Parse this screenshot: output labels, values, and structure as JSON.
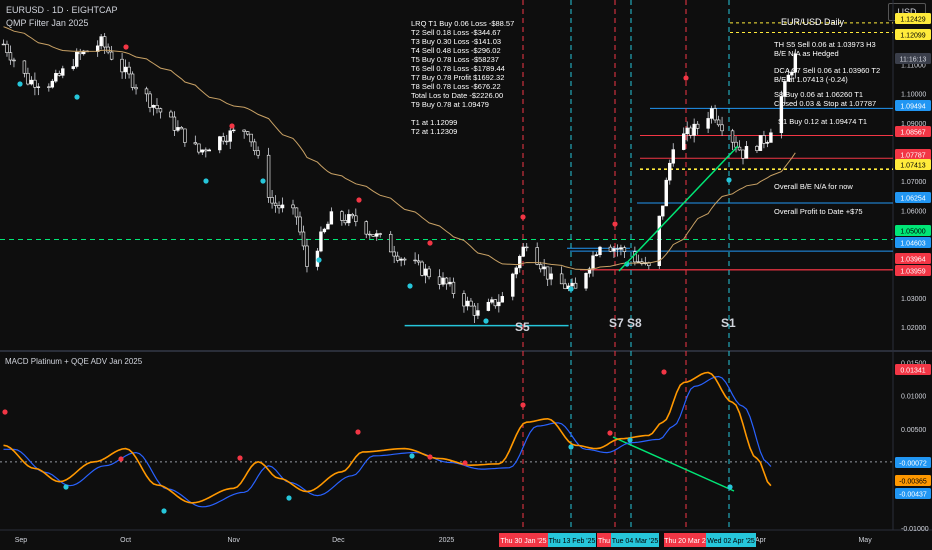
{
  "header": {
    "symbol_line": "EURUSD · 1D · EIGHTCAP",
    "indicator_line": "QMP Filter Jan 2025",
    "currency_button": "USD",
    "lower_indicator_title": "MACD Platinum + QQE ADV Jan 2025"
  },
  "annotations": {
    "trade_log": [
      "LRQ T1 Buy 0.06 Loss -$88.57",
      "T2 Sell 0.18 Loss -$344.67",
      "T3 Buy 0.30 Loss -$141.03",
      "T4 Sell 0.48 Loss -$296.02",
      "T5 Buy 0.78 Loss -$58237",
      "T6 Sell 0.78 Loss -$1789.44",
      "T7 Buy 0.78 Profit $1692.32",
      "T8 Sell 0.78 Loss -$676.22",
      "Total Los to Date -$2226.00",
      "T9 Buy 0.78 at 1.09479",
      "",
      "T1 at 1.12099",
      "T2 at 1.12309"
    ],
    "title_right": "EUR/USD Daily",
    "th_s5": [
      "TH S5 Sell 0.06 at 1.03973 H3",
      "B/E N/A as Hedged"
    ],
    "dca_s7": [
      "DCA S7 Sell 0.06 at 1.03960 T2",
      "B/E at 1.07413 (-0.24)"
    ],
    "s8": [
      "S8 Buy 0.06 at 1.06260 T1",
      "Closed 0.03 & Stop at 1.07787"
    ],
    "s1": "S1 Buy 0.12 at 1.09474 T1",
    "overall_be": "Overall B/E N/A for now",
    "overall_profit": "Overall Profit to Date +$75",
    "signals": [
      "S5",
      "S7",
      "S8",
      "S1"
    ]
  },
  "price_axis": {
    "ticks": [
      "1.11000",
      "1.10000",
      "1.09000",
      "1.08000",
      "1.07000",
      "1.06000",
      "1.05000",
      "1.04000",
      "1.03000",
      "1.02000"
    ],
    "badges": [
      {
        "label": "1.12429",
        "value": 1.12429,
        "bg": "#ffeb3b",
        "fg": "#000000"
      },
      {
        "label": "1.12099",
        "value": 1.12099,
        "bg": "#ffeb3b",
        "fg": "#000000"
      },
      {
        "label": "11:16:13",
        "value": 1.111,
        "bg": "#3a3e4a",
        "fg": "#d1d4dc"
      },
      {
        "label": "1.09494",
        "value": 1.09494,
        "bg": "#2196f3",
        "fg": "#ffffff"
      },
      {
        "label": "1.08567",
        "value": 1.08567,
        "bg": "#f23645",
        "fg": "#ffffff"
      },
      {
        "label": "1.07787",
        "value": 1.07787,
        "bg": "#f23645",
        "fg": "#ffffff"
      },
      {
        "label": "1.07413",
        "value": 1.07413,
        "bg": "#ffeb3b",
        "fg": "#000000"
      },
      {
        "label": "1.06254",
        "value": 1.06254,
        "bg": "#2196f3",
        "fg": "#ffffff"
      },
      {
        "label": "1.05000",
        "value": 1.05,
        "bg": "#00e676",
        "fg": "#000000"
      },
      {
        "label": "1.04603",
        "value": 1.04603,
        "bg": "#2196f3",
        "fg": "#ffffff"
      },
      {
        "label": "1.03964",
        "value": 1.03964,
        "bg": "#f23645",
        "fg": "#ffffff"
      },
      {
        "label": "1.03959",
        "value": 1.03959,
        "bg": "#f23645",
        "fg": "#ffffff"
      }
    ]
  },
  "macd_axis": {
    "ticks": [
      "0.01500",
      "0.01000",
      "0.00500",
      "0.00000",
      "-0.00500",
      "-0.01000"
    ],
    "badges": [
      {
        "label": "0.01341",
        "value": 0.01341,
        "bg": "#f23645",
        "fg": "#ffffff"
      },
      {
        "label": "-0.00072",
        "value": -0.00072,
        "bg": "#2196f3",
        "fg": "#ffffff"
      },
      {
        "label": "-0.00365",
        "value": -0.00365,
        "bg": "#ff9800",
        "fg": "#000000"
      },
      {
        "label": "-0.00437",
        "value": -0.00437,
        "bg": "#2196f3",
        "fg": "#ffffff"
      }
    ]
  },
  "time_axis": {
    "months": [
      "Sep",
      "Oct",
      "Nov",
      "Dec",
      "2025",
      "Feb",
      "Mar",
      "Apr",
      "May"
    ],
    "date_badges": [
      {
        "label": "Thu 30 Jan '25",
        "color": "#f23645"
      },
      {
        "label": "Thu 13 Feb '25",
        "color": "#26c6da"
      },
      {
        "label": "Thu",
        "color": "#f23645"
      },
      {
        "label": "Tue 04 Mar '25",
        "color": "#26c6da"
      },
      {
        "label": "Thu 20 Mar 2",
        "color": "#f23645"
      },
      {
        "label": "Wed 02 Apr '25",
        "color": "#26c6da"
      }
    ]
  },
  "colors": {
    "background": "#0e0e0e",
    "up_candle": "#ffffff",
    "down_candle": "#ffffff",
    "ma_line": "#c8a165",
    "macd_fast": "#ff9800",
    "macd_slow": "#2962ff",
    "signal_red": "#f23645",
    "signal_cyan": "#26c6da",
    "trend_green": "#00e676"
  },
  "chart_data": [
    {
      "type": "candlestick",
      "title": "EURUSD · 1D · EIGHTCAP",
      "x_range": [
        "2024-08-26",
        "2025-05-09"
      ],
      "ylim": [
        1.0135,
        1.128
      ],
      "close_path": [
        {
          "date": "2024-08-27",
          "close": 1.117
        },
        {
          "date": "2024-09-03",
          "close": 1.1045
        },
        {
          "date": "2024-09-10",
          "close": 1.1035
        },
        {
          "date": "2024-09-17",
          "close": 1.1125
        },
        {
          "date": "2024-09-24",
          "close": 1.1175
        },
        {
          "date": "2024-10-01",
          "close": 1.107
        },
        {
          "date": "2024-10-08",
          "close": 1.0975
        },
        {
          "date": "2024-10-15",
          "close": 1.089
        },
        {
          "date": "2024-10-22",
          "close": 1.08
        },
        {
          "date": "2024-10-29",
          "close": 1.0855
        },
        {
          "date": "2024-11-05",
          "close": 1.088
        },
        {
          "date": "2024-11-12",
          "close": 1.0625
        },
        {
          "date": "2024-11-19",
          "close": 1.058
        },
        {
          "date": "2024-11-22",
          "close": 1.041
        },
        {
          "date": "2024-11-29",
          "close": 1.0575
        },
        {
          "date": "2024-12-06",
          "close": 1.0565
        },
        {
          "date": "2024-12-13",
          "close": 1.05
        },
        {
          "date": "2024-12-20",
          "close": 1.043
        },
        {
          "date": "2024-12-31",
          "close": 1.0355
        },
        {
          "date": "2025-01-10",
          "close": 1.0245
        },
        {
          "date": "2025-01-17",
          "close": 1.03
        },
        {
          "date": "2025-01-24",
          "close": 1.0495
        },
        {
          "date": "2025-01-31",
          "close": 1.036
        },
        {
          "date": "2025-02-07",
          "close": 1.0325
        },
        {
          "date": "2025-02-14",
          "close": 1.049
        },
        {
          "date": "2025-02-21",
          "close": 1.046
        },
        {
          "date": "2025-02-28",
          "close": 1.04
        },
        {
          "date": "2025-03-04",
          "close": 1.0625
        },
        {
          "date": "2025-03-07",
          "close": 1.083
        },
        {
          "date": "2025-03-14",
          "close": 1.0885
        },
        {
          "date": "2025-03-18",
          "close": 1.0945
        },
        {
          "date": "2025-03-27",
          "close": 1.0795
        },
        {
          "date": "2025-04-03",
          "close": 1.085
        },
        {
          "date": "2025-04-11",
          "close": 1.1125
        }
      ],
      "horizontal_levels": [
        1.12429,
        1.12099,
        1.09494,
        1.08567,
        1.07787,
        1.07413,
        1.06254,
        1.05,
        1.04603,
        1.03964,
        1.03959
      ],
      "support_line": {
        "from": {
          "date": "2024-12-20",
          "price": 1.0205
        },
        "to": {
          "date": "2025-02-05",
          "price": 1.0205
        }
      }
    },
    {
      "type": "line",
      "title": "MACD Platinum + QQE ADV Jan 2025",
      "ylim": [
        -0.01,
        0.016
      ],
      "series": [
        {
          "name": "",
          "values": [
            {
              "date": "2024-08-27",
              "value": 0.0025
            },
            {
              "date": "2024-09-05",
              "value": -0.001
            },
            {
              "date": "2024-09-12",
              "value": -0.003
            },
            {
              "date": "2024-09-22",
              "value": 0.0
            },
            {
              "date": "2024-10-01",
              "value": 0.002
            },
            {
              "date": "2024-10-10",
              "value": -0.0035
            },
            {
              "date": "2024-10-20",
              "value": -0.0062
            },
            {
              "date": "2024-11-01",
              "value": -0.004
            },
            {
              "date": "2024-11-08",
              "value": 0.0
            },
            {
              "date": "2024-11-14",
              "value": -0.0025
            },
            {
              "date": "2024-11-22",
              "value": -0.0045
            },
            {
              "date": "2024-12-02",
              "value": -0.0015
            },
            {
              "date": "2024-12-08",
              "value": 0.0015
            },
            {
              "date": "2024-12-20",
              "value": 0.002
            },
            {
              "date": "2024-12-30",
              "value": 0.0005
            },
            {
              "date": "2025-01-08",
              "value": -0.0005
            },
            {
              "date": "2025-01-16",
              "value": -0.0003
            },
            {
              "date": "2025-01-24",
              "value": 0.006
            },
            {
              "date": "2025-01-30",
              "value": 0.0065
            },
            {
              "date": "2025-02-07",
              "value": 0.0025
            },
            {
              "date": "2025-02-13",
              "value": 0.002
            },
            {
              "date": "2025-02-20",
              "value": 0.0035
            },
            {
              "date": "2025-02-28",
              "value": 0.004
            },
            {
              "date": "2025-03-04",
              "value": 0.006
            },
            {
              "date": "2025-03-10",
              "value": 0.012
            },
            {
              "date": "2025-03-17",
              "value": 0.0135
            },
            {
              "date": "2025-03-24",
              "value": 0.009
            },
            {
              "date": "2025-03-31",
              "value": 0.0005
            },
            {
              "date": "2025-04-04",
              "value": -0.0036
            }
          ]
        }
      ]
    }
  ]
}
